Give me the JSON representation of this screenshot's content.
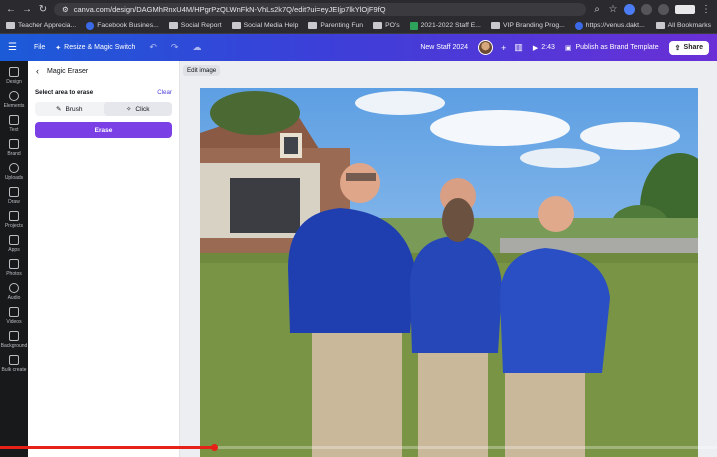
{
  "browser": {
    "url": "canva.com/design/DAGMhRnxU4M/HPgrPzQLWnFkN-VhLs2k7Q/edit?ui=eyJEIjp7lkYlOjF9fQ",
    "bookmarks": [
      {
        "label": "Teacher Apprecia...",
        "icon": "folder"
      },
      {
        "label": "Facebook Busines...",
        "icon": "favicon"
      },
      {
        "label": "Social Report",
        "icon": "folder"
      },
      {
        "label": "Social Media Help",
        "icon": "folder"
      },
      {
        "label": "Parenting Fun",
        "icon": "folder"
      },
      {
        "label": "PO's",
        "icon": "folder"
      },
      {
        "label": "2021-2022 Staff E...",
        "icon": "sheets"
      },
      {
        "label": "VIP Branding Prog...",
        "icon": "folder"
      },
      {
        "label": "https://venus.dakt...",
        "icon": "favicon"
      }
    ],
    "all_bookmarks": "All Bookmarks"
  },
  "topbar": {
    "file": "File",
    "resize": "Resize & Magic Switch",
    "doc_title": "New Staff 2024",
    "timer": "2:43",
    "publish": "Publish as Brand Template",
    "share": "Share"
  },
  "rail": [
    {
      "label": "Design",
      "icon": "design-icon"
    },
    {
      "label": "Elements",
      "icon": "elements-icon"
    },
    {
      "label": "Text",
      "icon": "text-icon"
    },
    {
      "label": "Brand",
      "icon": "brand-icon"
    },
    {
      "label": "Uploads",
      "icon": "uploads-icon"
    },
    {
      "label": "Draw",
      "icon": "draw-icon"
    },
    {
      "label": "Projects",
      "icon": "projects-icon"
    },
    {
      "label": "Apps",
      "icon": "apps-icon"
    },
    {
      "label": "Photos",
      "icon": "photos-icon"
    },
    {
      "label": "Audio",
      "icon": "audio-icon"
    },
    {
      "label": "Videos",
      "icon": "videos-icon"
    },
    {
      "label": "Background",
      "icon": "background-icon"
    },
    {
      "label": "Bulk create",
      "icon": "bulk-create-icon"
    }
  ],
  "panel": {
    "title": "Magic Eraser",
    "select_label": "Select area to erase",
    "clear": "Clear",
    "brush": "Brush",
    "click": "Click",
    "erase": "Erase"
  },
  "canvas": {
    "edit_image": "Edit image"
  },
  "video_progress": 0.3
}
